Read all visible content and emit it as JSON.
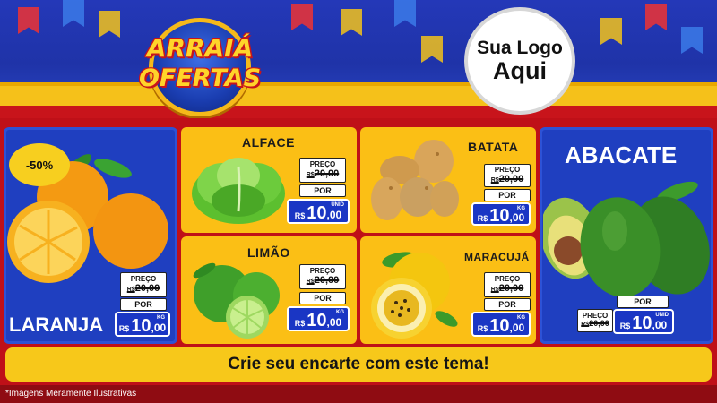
{
  "header": {
    "logo_line1": "ARRAIÁ",
    "logo_line2": "OFERTAS",
    "your_logo_line1": "Sua Logo",
    "your_logo_line2": "Aqui"
  },
  "products": [
    {
      "name": "LARANJA",
      "badge": "-50%",
      "preco_label": "PREÇO",
      "old_currency": "R$",
      "old_price": "20,00",
      "por_label": "POR",
      "currency": "R$",
      "price_int": "10",
      "price_dec": ",00",
      "unit": "KG"
    },
    {
      "name": "ALFACE",
      "preco_label": "PREÇO",
      "old_currency": "R$",
      "old_price": "20,00",
      "por_label": "POR",
      "currency": "R$",
      "price_int": "10",
      "price_dec": ",00",
      "unit": "UNID"
    },
    {
      "name": "BATATA",
      "preco_label": "PREÇO",
      "old_currency": "R$",
      "old_price": "20,00",
      "por_label": "POR",
      "currency": "R$",
      "price_int": "10",
      "price_dec": ",00",
      "unit": "KG"
    },
    {
      "name": "ABACATE",
      "preco_label": "PREÇO",
      "old_currency": "R$",
      "old_price": "20,00",
      "por_label": "POR",
      "currency": "R$",
      "price_int": "10",
      "price_dec": ",00",
      "unit": "UNID"
    },
    {
      "name": "LIMÃO",
      "preco_label": "PREÇO",
      "old_currency": "R$",
      "old_price": "20,00",
      "por_label": "POR",
      "currency": "R$",
      "price_int": "10",
      "price_dec": ",00",
      "unit": "KG"
    },
    {
      "name": "MARACUJÁ",
      "preco_label": "PREÇO",
      "old_currency": "R$",
      "old_price": "20,00",
      "por_label": "POR",
      "currency": "R$",
      "price_int": "10",
      "price_dec": ",00",
      "unit": "KG"
    }
  ],
  "cta_text": "Crie seu encarte com este tema!",
  "disclaimer": "*Imagens Meramente Ilustrativas",
  "colors": {
    "blue": "#1f3fc0",
    "yellow": "#fbbf15",
    "red": "#bf1018",
    "price_blue": "#1a36c4"
  }
}
